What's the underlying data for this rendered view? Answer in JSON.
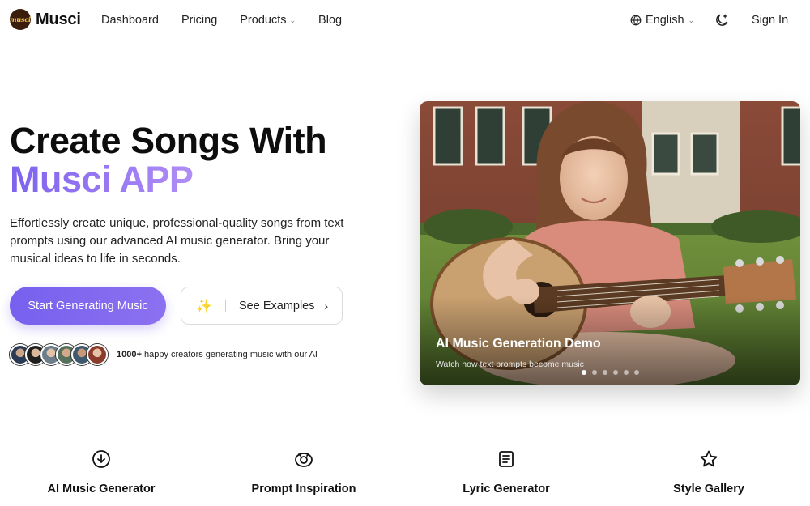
{
  "brand": {
    "name": "Musci",
    "logo_text": "musci"
  },
  "nav": {
    "links": [
      {
        "label": "Dashboard"
      },
      {
        "label": "Pricing"
      },
      {
        "label": "Products"
      },
      {
        "label": "Blog"
      }
    ],
    "language": "English",
    "sign_in": "Sign In"
  },
  "hero": {
    "title_line1": "Create Songs With",
    "title_line2": "Musci APP",
    "description": "Effortlessly create unique, professional-quality songs from text prompts using our advanced AI music generator. Bring your musical ideas to life in seconds.",
    "primary_button": "Start Generating Music",
    "secondary_button": "See Examples",
    "creators_count": "1000+",
    "creators_text": "happy creators generating music with our AI"
  },
  "carousel": {
    "title": "AI Music Generation Demo",
    "subtitle": "Watch how text prompts become music",
    "slide_count": 6,
    "active_slide": 1
  },
  "features": [
    {
      "label": "AI Music Generator",
      "icon": "download-circle-icon"
    },
    {
      "label": "Prompt Inspiration",
      "icon": "eye-target-icon"
    },
    {
      "label": "Lyric Generator",
      "icon": "document-icon"
    },
    {
      "label": "Style Gallery",
      "icon": "star-icon"
    }
  ],
  "colors": {
    "accent": "#7e63ee",
    "accent_light": "#b08ef5"
  }
}
